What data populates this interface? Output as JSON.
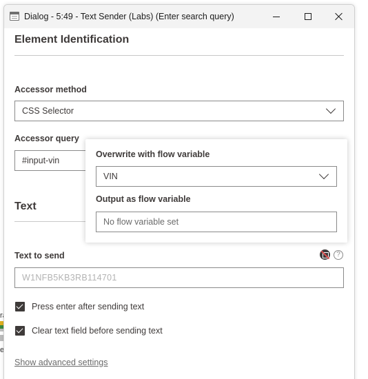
{
  "window": {
    "title": "Dialog - 5:49 - Text Sender (Labs) (Enter search query)"
  },
  "background_fragments": [
    "ra",
    "e"
  ],
  "element_identification": {
    "heading": "Element Identification",
    "accessor_method_label": "Accessor method",
    "accessor_method_value": "CSS Selector",
    "accessor_query_label": "Accessor query",
    "accessor_query_value": "#input-vin"
  },
  "text_section": {
    "heading": "Text",
    "text_to_send_label": "Text to send",
    "text_to_send_placeholder": "W1NFB5KB3RB114701",
    "help_glyph": "?",
    "options": [
      {
        "label": "Press enter after sending text",
        "checked": true
      },
      {
        "label": "Clear text field before sending text",
        "checked": true
      }
    ],
    "advanced_link": "Show advanced settings"
  },
  "flow_variable_popover": {
    "overwrite_label": "Overwrite with flow variable",
    "overwrite_value": "VIN",
    "output_label": "Output as flow variable",
    "output_placeholder": "No flow variable set"
  },
  "icons": {
    "app": "dialog-window-icon",
    "flow_variable": "flow-variable-icon",
    "help": "help-icon",
    "dropdown": "chevron-down-icon"
  }
}
